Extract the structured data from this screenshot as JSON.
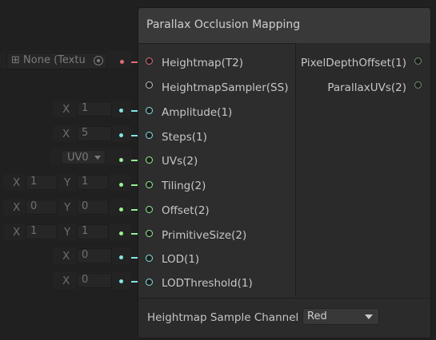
{
  "node": {
    "title": "Parallax Occlusion Mapping",
    "inputs": [
      {
        "label": "Heightmap(T2)"
      },
      {
        "label": "HeightmapSampler(SS)"
      },
      {
        "label": "Amplitude(1)"
      },
      {
        "label": "Steps(1)"
      },
      {
        "label": "UVs(2)"
      },
      {
        "label": "Tiling(2)"
      },
      {
        "label": "Offset(2)"
      },
      {
        "label": "PrimitiveSize(2)"
      },
      {
        "label": "LOD(1)"
      },
      {
        "label": "LODThreshold(1)"
      }
    ],
    "outputs": [
      {
        "label": "PixelDepthOffset(1)"
      },
      {
        "label": "ParallaxUVs(2)"
      }
    ],
    "footer": {
      "label": "Heightmap Sample Channel",
      "channel": "Red"
    }
  },
  "inline_inputs": {
    "heightmap_texture": "None (Textu",
    "amplitude": {
      "axis": "X",
      "value": "1"
    },
    "steps": {
      "axis": "X",
      "value": "5"
    },
    "uvs": "UV0",
    "tiling": {
      "x_axis": "X",
      "x": "1",
      "y_axis": "Y",
      "y": "1"
    },
    "offset": {
      "x_axis": "X",
      "x": "0",
      "y_axis": "Y",
      "y": "0"
    },
    "primitive_size": {
      "x_axis": "X",
      "x": "1",
      "y_axis": "Y",
      "y": "1"
    },
    "lod": {
      "axis": "X",
      "value": "0"
    },
    "lod_threshold": {
      "axis": "X",
      "value": "0"
    }
  },
  "colors": {
    "texture": "#e06b76",
    "float": "#84e4e7",
    "vector2": "#9aef92",
    "sampler": "#bfbfbf",
    "output_port": "#6c8f6c"
  }
}
